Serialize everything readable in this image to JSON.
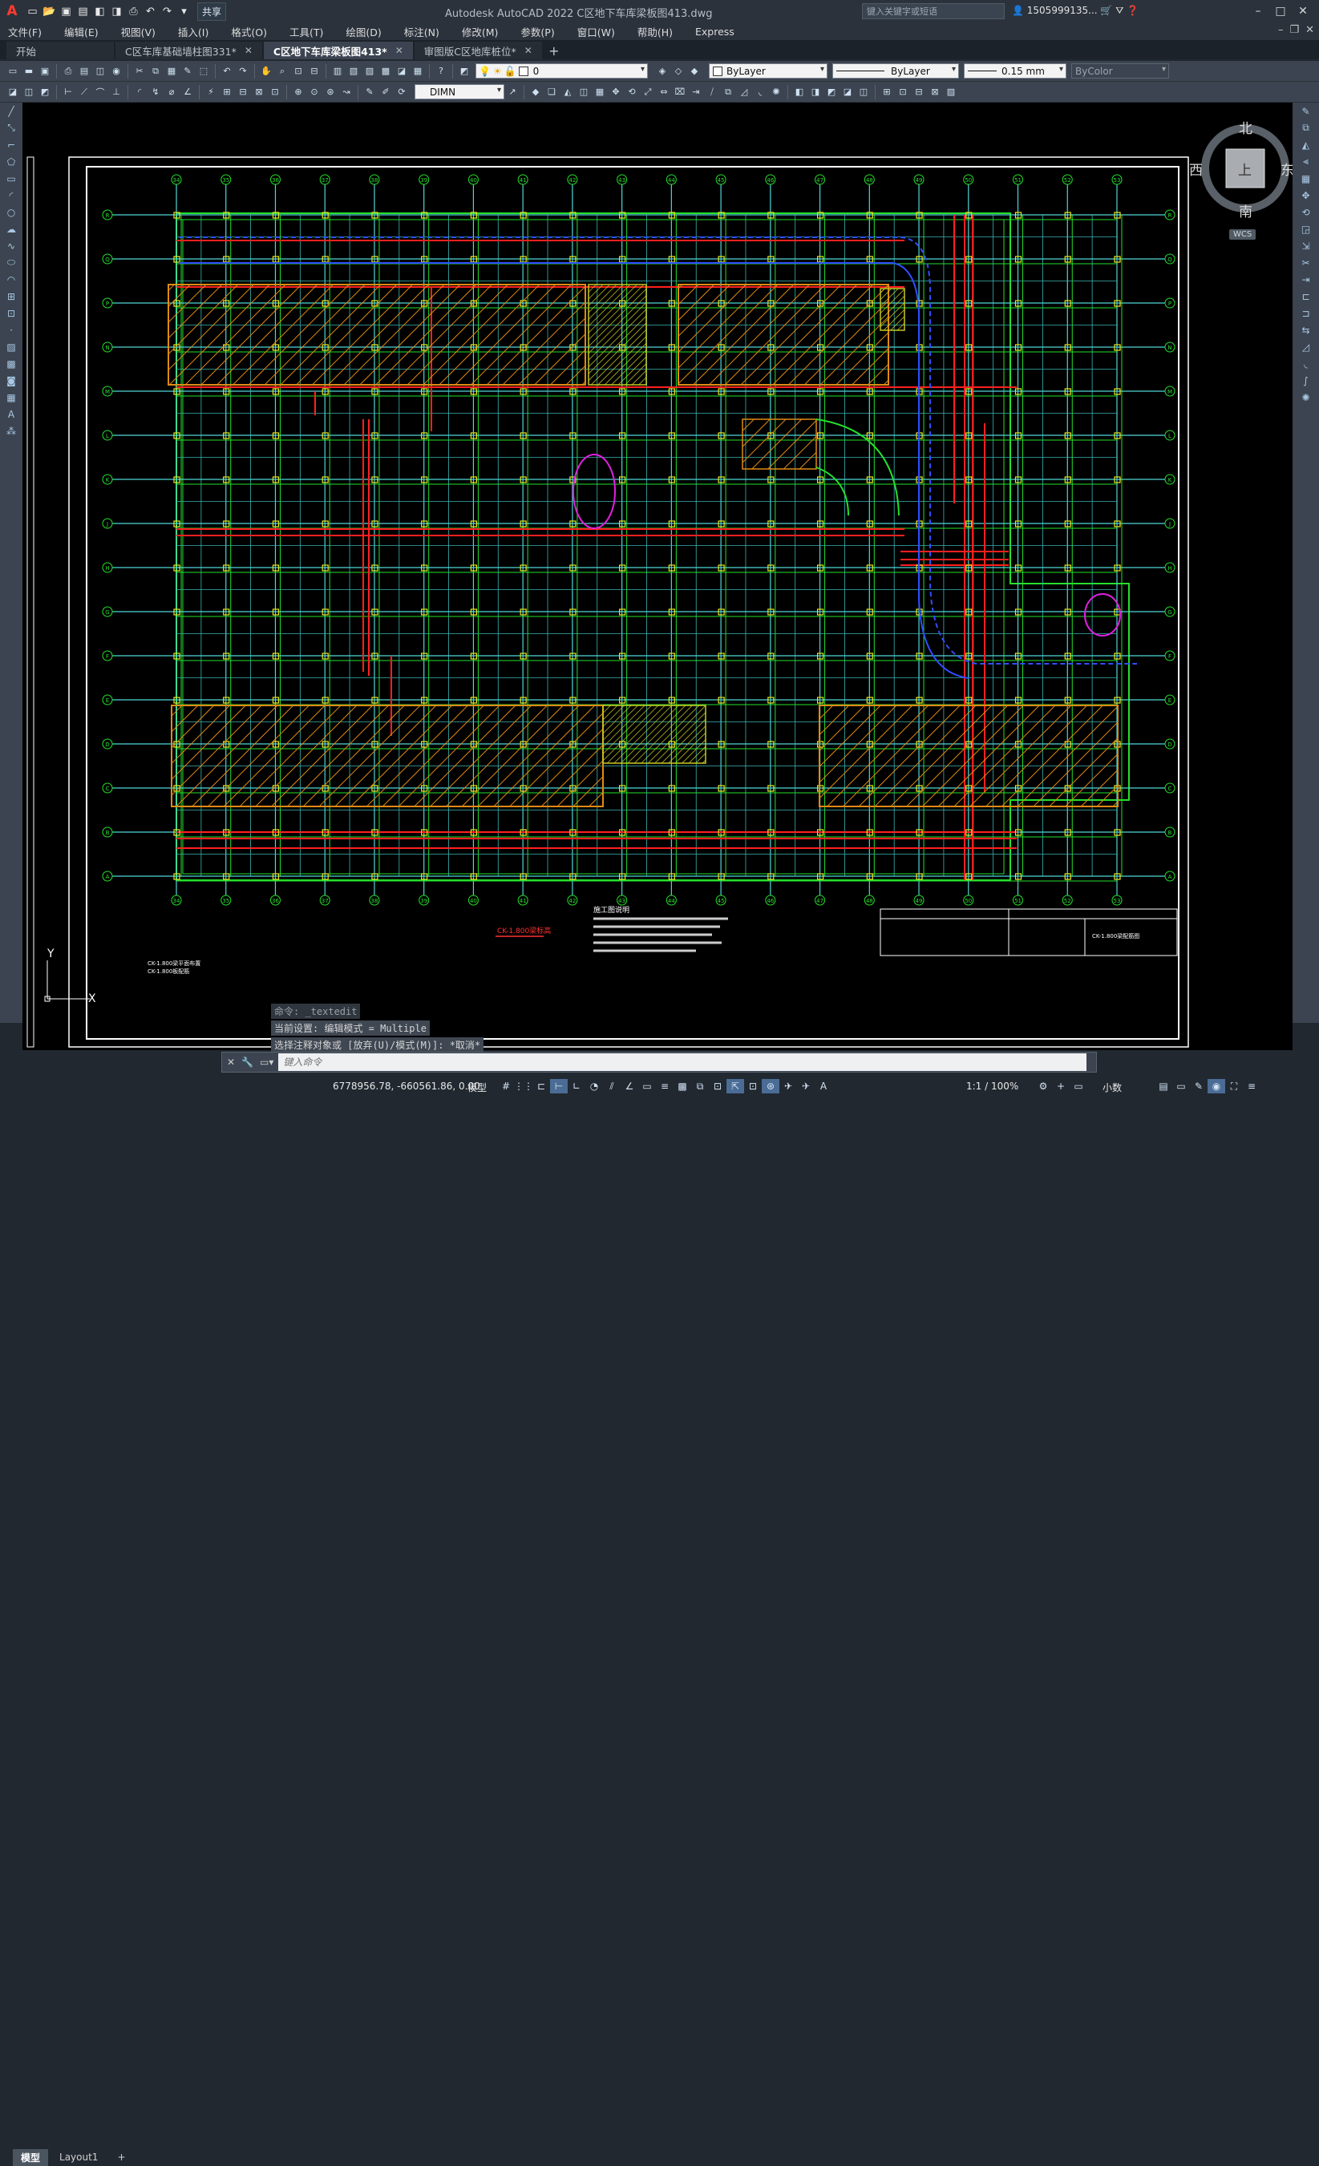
{
  "app": {
    "logo_letter": "A",
    "window_title": "Autodesk AutoCAD 2022    C区地下车库梁板图413.dwg",
    "share_label": "共享",
    "search_placeholder": "键入关键字或短语",
    "username": "1505999135...",
    "window_controls": [
      "–",
      "□",
      "✕"
    ]
  },
  "menu": {
    "items": [
      "文件(F)",
      "编辑(E)",
      "视图(V)",
      "插入(I)",
      "格式(O)",
      "工具(T)",
      "绘图(D)",
      "标注(N)",
      "修改(M)",
      "参数(P)",
      "窗口(W)",
      "帮助(H)",
      "Express"
    ]
  },
  "tabs": {
    "items": [
      {
        "label": "开始"
      },
      {
        "label": "C区车库基础墙柱图331*"
      },
      {
        "label": "C区地下车库梁板图413*"
      },
      {
        "label": "审图版C区地库桩位*"
      }
    ],
    "active_index": 2,
    "close_glyph": "✕",
    "add_glyph": "+"
  },
  "toolbar": {
    "layer_value": "0",
    "color_value": "ByLayer",
    "linetype_value": "ByLayer",
    "lineweight_value": "0.15 mm",
    "plotstyle_value": "ByColor",
    "dimstyle_value": "DIMN"
  },
  "viewcube": {
    "north": "北",
    "south": "南",
    "east": "东",
    "west": "西",
    "top_face": "上",
    "wcs": "WCS"
  },
  "ucs": {
    "y_label": "Y",
    "x_label": "X"
  },
  "drawing": {
    "grid_top_labels": [
      "34",
      "35",
      "36",
      "37",
      "38",
      "39",
      "40",
      "41",
      "42",
      "43",
      "44",
      "45",
      "46",
      "47",
      "48",
      "49",
      "50",
      "51",
      "52",
      "53"
    ],
    "grid_left_labels": [
      "R",
      "Q",
      "P",
      "N",
      "M",
      "L",
      "K",
      "J",
      "H",
      "G",
      "F",
      "E",
      "D",
      "C",
      "B",
      "A"
    ],
    "notes_title": "施工图说明",
    "legend_text": "CK-1.800梁标高",
    "title_block_text": "CK-1.800梁配筋图",
    "left_note_1": "CK-1.800梁平面布置",
    "left_note_2": "CK-1.800板配筋"
  },
  "command": {
    "history": [
      "命令: _textedit",
      "当前设置: 编辑模式 = Multiple",
      "选择注释对象或 [放弃(U)/模式(M)]: *取消*"
    ],
    "placeholder": "键入命令"
  },
  "layout_tabs": [
    "模型",
    "Layout1"
  ],
  "layout_add": "+",
  "status": {
    "coordinates": "6778956.78, -660561.86, 0.00",
    "space": "模型",
    "annotation_scale": "1:1 / 100%",
    "units": "小数"
  },
  "colors": {
    "background": "#000000",
    "grid_cyan": "#4fd6d6",
    "beam_green": "#25e02b",
    "beam_red": "#ff2020",
    "hatch_orange": "#e08a14",
    "hatch_yellow": "#c8c820",
    "markup_magenta": "#e020e0",
    "blue_arc": "#2f4fff"
  }
}
